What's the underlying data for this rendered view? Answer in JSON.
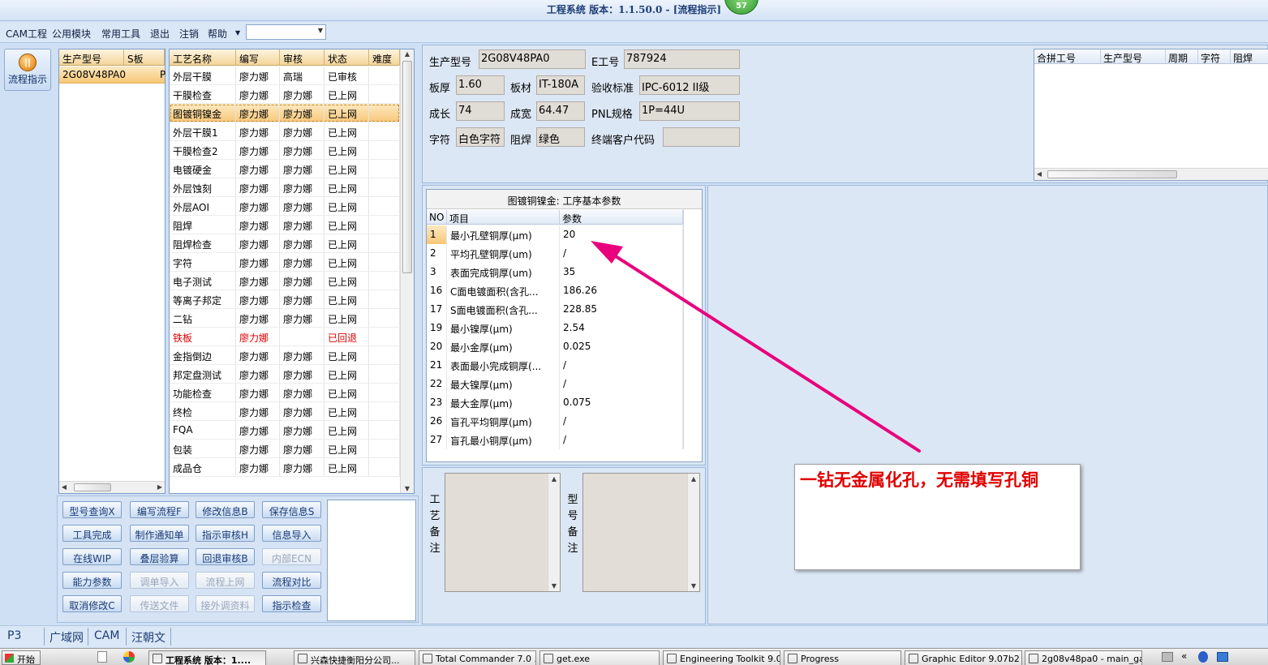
{
  "titlebar": {
    "text": "工程系统  版本：1.1.50.0 - [流程指示]",
    "badge": "57"
  },
  "menu": [
    "CAM工程",
    "公用模块",
    "常用工具",
    "退出",
    "注销",
    "帮助"
  ],
  "sidebar": {
    "button": "流程指示"
  },
  "model_list": {
    "headers": [
      "生产型号",
      "S板"
    ],
    "rows": [
      [
        "2G08V48PA0",
        "P"
      ]
    ]
  },
  "process_table": {
    "headers": [
      "工艺名称",
      "编写",
      "审核",
      "状态",
      "难度"
    ],
    "rows": [
      [
        "外层干膜",
        "廖力娜",
        "高瑞",
        "已审核",
        ""
      ],
      [
        "干膜检查",
        "廖力娜",
        "廖力娜",
        "已上网",
        ""
      ],
      [
        "图镀铜镍金",
        "廖力娜",
        "廖力娜",
        "已上网",
        ""
      ],
      [
        "外层干膜1",
        "廖力娜",
        "廖力娜",
        "已上网",
        ""
      ],
      [
        "干膜检查2",
        "廖力娜",
        "廖力娜",
        "已上网",
        ""
      ],
      [
        "电镀硬金",
        "廖力娜",
        "廖力娜",
        "已上网",
        ""
      ],
      [
        "外层蚀刻",
        "廖力娜",
        "廖力娜",
        "已上网",
        ""
      ],
      [
        "外层AOI",
        "廖力娜",
        "廖力娜",
        "已上网",
        ""
      ],
      [
        "阻焊",
        "廖力娜",
        "廖力娜",
        "已上网",
        ""
      ],
      [
        "阻焊检查",
        "廖力娜",
        "廖力娜",
        "已上网",
        ""
      ],
      [
        "字符",
        "廖力娜",
        "廖力娜",
        "已上网",
        ""
      ],
      [
        "电子测试",
        "廖力娜",
        "廖力娜",
        "已上网",
        ""
      ],
      [
        "等离子邦定",
        "廖力娜",
        "廖力娜",
        "已上网",
        ""
      ],
      [
        "二钻",
        "廖力娜",
        "廖力娜",
        "已上网",
        ""
      ],
      [
        "铁板",
        "廖力娜",
        "",
        "已回退",
        ""
      ],
      [
        "金指倒边",
        "廖力娜",
        "廖力娜",
        "已上网",
        ""
      ],
      [
        "邦定盘测试",
        "廖力娜",
        "廖力娜",
        "已上网",
        ""
      ],
      [
        "功能检查",
        "廖力娜",
        "廖力娜",
        "已上网",
        ""
      ],
      [
        "终检",
        "廖力娜",
        "廖力娜",
        "已上网",
        ""
      ],
      [
        "FQA",
        "廖力娜",
        "廖力娜",
        "已上网",
        ""
      ],
      [
        "包装",
        "廖力娜",
        "廖力娜",
        "已上网",
        ""
      ],
      [
        "成品仓",
        "廖力娜",
        "廖力娜",
        "已上网",
        ""
      ]
    ]
  },
  "buttons": [
    {
      "label": "型号查询X",
      "enabled": true
    },
    {
      "label": "编写流程F",
      "enabled": true
    },
    {
      "label": "修改信息B",
      "enabled": true
    },
    {
      "label": "保存信息S",
      "enabled": true
    },
    {
      "label": "工具完成",
      "enabled": true
    },
    {
      "label": "制作通知单",
      "enabled": true
    },
    {
      "label": "指示审核H",
      "enabled": true
    },
    {
      "label": "信息导入",
      "enabled": true
    },
    {
      "label": "在线WIP",
      "enabled": true
    },
    {
      "label": "叠层验算",
      "enabled": true
    },
    {
      "label": "回退审核B",
      "enabled": true
    },
    {
      "label": "内部ECN",
      "enabled": false
    },
    {
      "label": "能力参数",
      "enabled": true
    },
    {
      "label": "调单导入",
      "enabled": false
    },
    {
      "label": "流程上网",
      "enabled": false
    },
    {
      "label": "流程对比",
      "enabled": true
    },
    {
      "label": "取消修改C",
      "enabled": true
    },
    {
      "label": "传送文件",
      "enabled": false
    },
    {
      "label": "接外调资料",
      "enabled": false
    },
    {
      "label": "指示检查",
      "enabled": true
    }
  ],
  "info": {
    "fields": [
      {
        "label": "生产型号",
        "value": "2G08V48PA0"
      },
      {
        "label": "E工号",
        "value": "787924"
      },
      {
        "label": "板厚",
        "value": "1.60"
      },
      {
        "label": "板材",
        "value": "IT-180A"
      },
      {
        "label": "验收标准",
        "value": "IPC-6012 II级"
      },
      {
        "label": "成长",
        "value": "74"
      },
      {
        "label": "成宽",
        "value": "64.47"
      },
      {
        "label": "PNL规格",
        "value": "1P=44U"
      },
      {
        "label": "字符",
        "value": "白色字符"
      },
      {
        "label": "阻焊",
        "value": "绿色"
      },
      {
        "label": "终端客户代码",
        "value": ""
      }
    ]
  },
  "merge_table": {
    "headers": [
      "合拼工号",
      "生产型号",
      "周期",
      "字符",
      "阻焊"
    ]
  },
  "params": {
    "title": "图镀铜镍金: 工序基本参数",
    "headers": [
      "NO",
      "项目",
      "参数"
    ],
    "rows": [
      [
        "1",
        "最小孔壁铜厚(μm)",
        "20"
      ],
      [
        "2",
        "平均孔壁铜厚(um)",
        "/"
      ],
      [
        "3",
        "表面完成铜厚(um)",
        "35"
      ],
      [
        "16",
        "C面电镀面积(含孔...",
        "186.26"
      ],
      [
        "17",
        "S面电镀面积(含孔...",
        "228.85"
      ],
      [
        "19",
        "最小镍厚(μm)",
        "2.54"
      ],
      [
        "20",
        "最小金厚(μm)",
        "0.025"
      ],
      [
        "21",
        "表面最小完成铜厚(...",
        "/"
      ],
      [
        "22",
        "最大镍厚(μm)",
        "/"
      ],
      [
        "23",
        "最大金厚(μm)",
        "0.075"
      ],
      [
        "26",
        "盲孔平均铜厚(μm)",
        "/"
      ],
      [
        "27",
        "盲孔最小铜厚(μm)",
        "/"
      ]
    ]
  },
  "memo": {
    "process_note_label": "工艺备注",
    "model_note_label": "型号备注"
  },
  "annotation": {
    "text": "一钻无金属化孔，无需填写孔铜",
    "color": "#e8007d"
  },
  "statusbar": {
    "tabs": [
      "P3",
      "广域网",
      "CAM",
      "汪朝文"
    ]
  },
  "taskbar": {
    "start": "开始",
    "items": [
      "工程系统 版本：1....",
      "兴森快捷衡阳分公司...",
      "Total Commander 7.0 ...",
      "get.exe",
      "Engineering Toolkit 9.0...",
      "Progress",
      "Graphic Editor 9.07b2 ...",
      "2g08v48pa0 - main_ga"
    ]
  }
}
